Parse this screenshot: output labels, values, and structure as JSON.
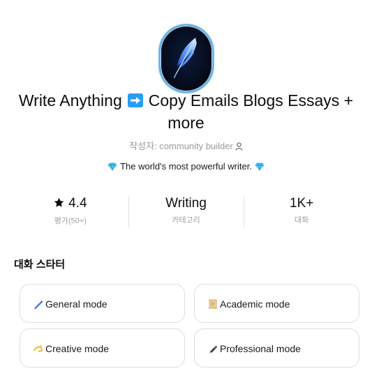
{
  "gpt": {
    "logo_icon": "quill-feather-icon",
    "title_part1": "Write Anything",
    "title_arrow_icon": "right-arrow-emoji-icon",
    "title_part2": "Copy Emails Blogs Essays + more",
    "author_prefix": "작성자: community builder",
    "author_icon": "person-icon",
    "tagline": "The world's most powerful writer.",
    "tagline_icon": "gem-icon"
  },
  "stats": [
    {
      "value": "4.4",
      "label": "평가(50+)",
      "icon": "star-icon"
    },
    {
      "value": "Writing",
      "label": "카테고리"
    },
    {
      "value": "1K+",
      "label": "대화"
    }
  ],
  "starters": {
    "heading": "대화 스타터",
    "items": [
      {
        "label": "General mode",
        "icon": "pen-icon"
      },
      {
        "label": "Academic mode",
        "icon": "scroll-icon"
      },
      {
        "label": "Creative mode",
        "icon": "dizzy-icon"
      },
      {
        "label": "Professional mode",
        "icon": "fountain-pen-icon"
      }
    ]
  }
}
